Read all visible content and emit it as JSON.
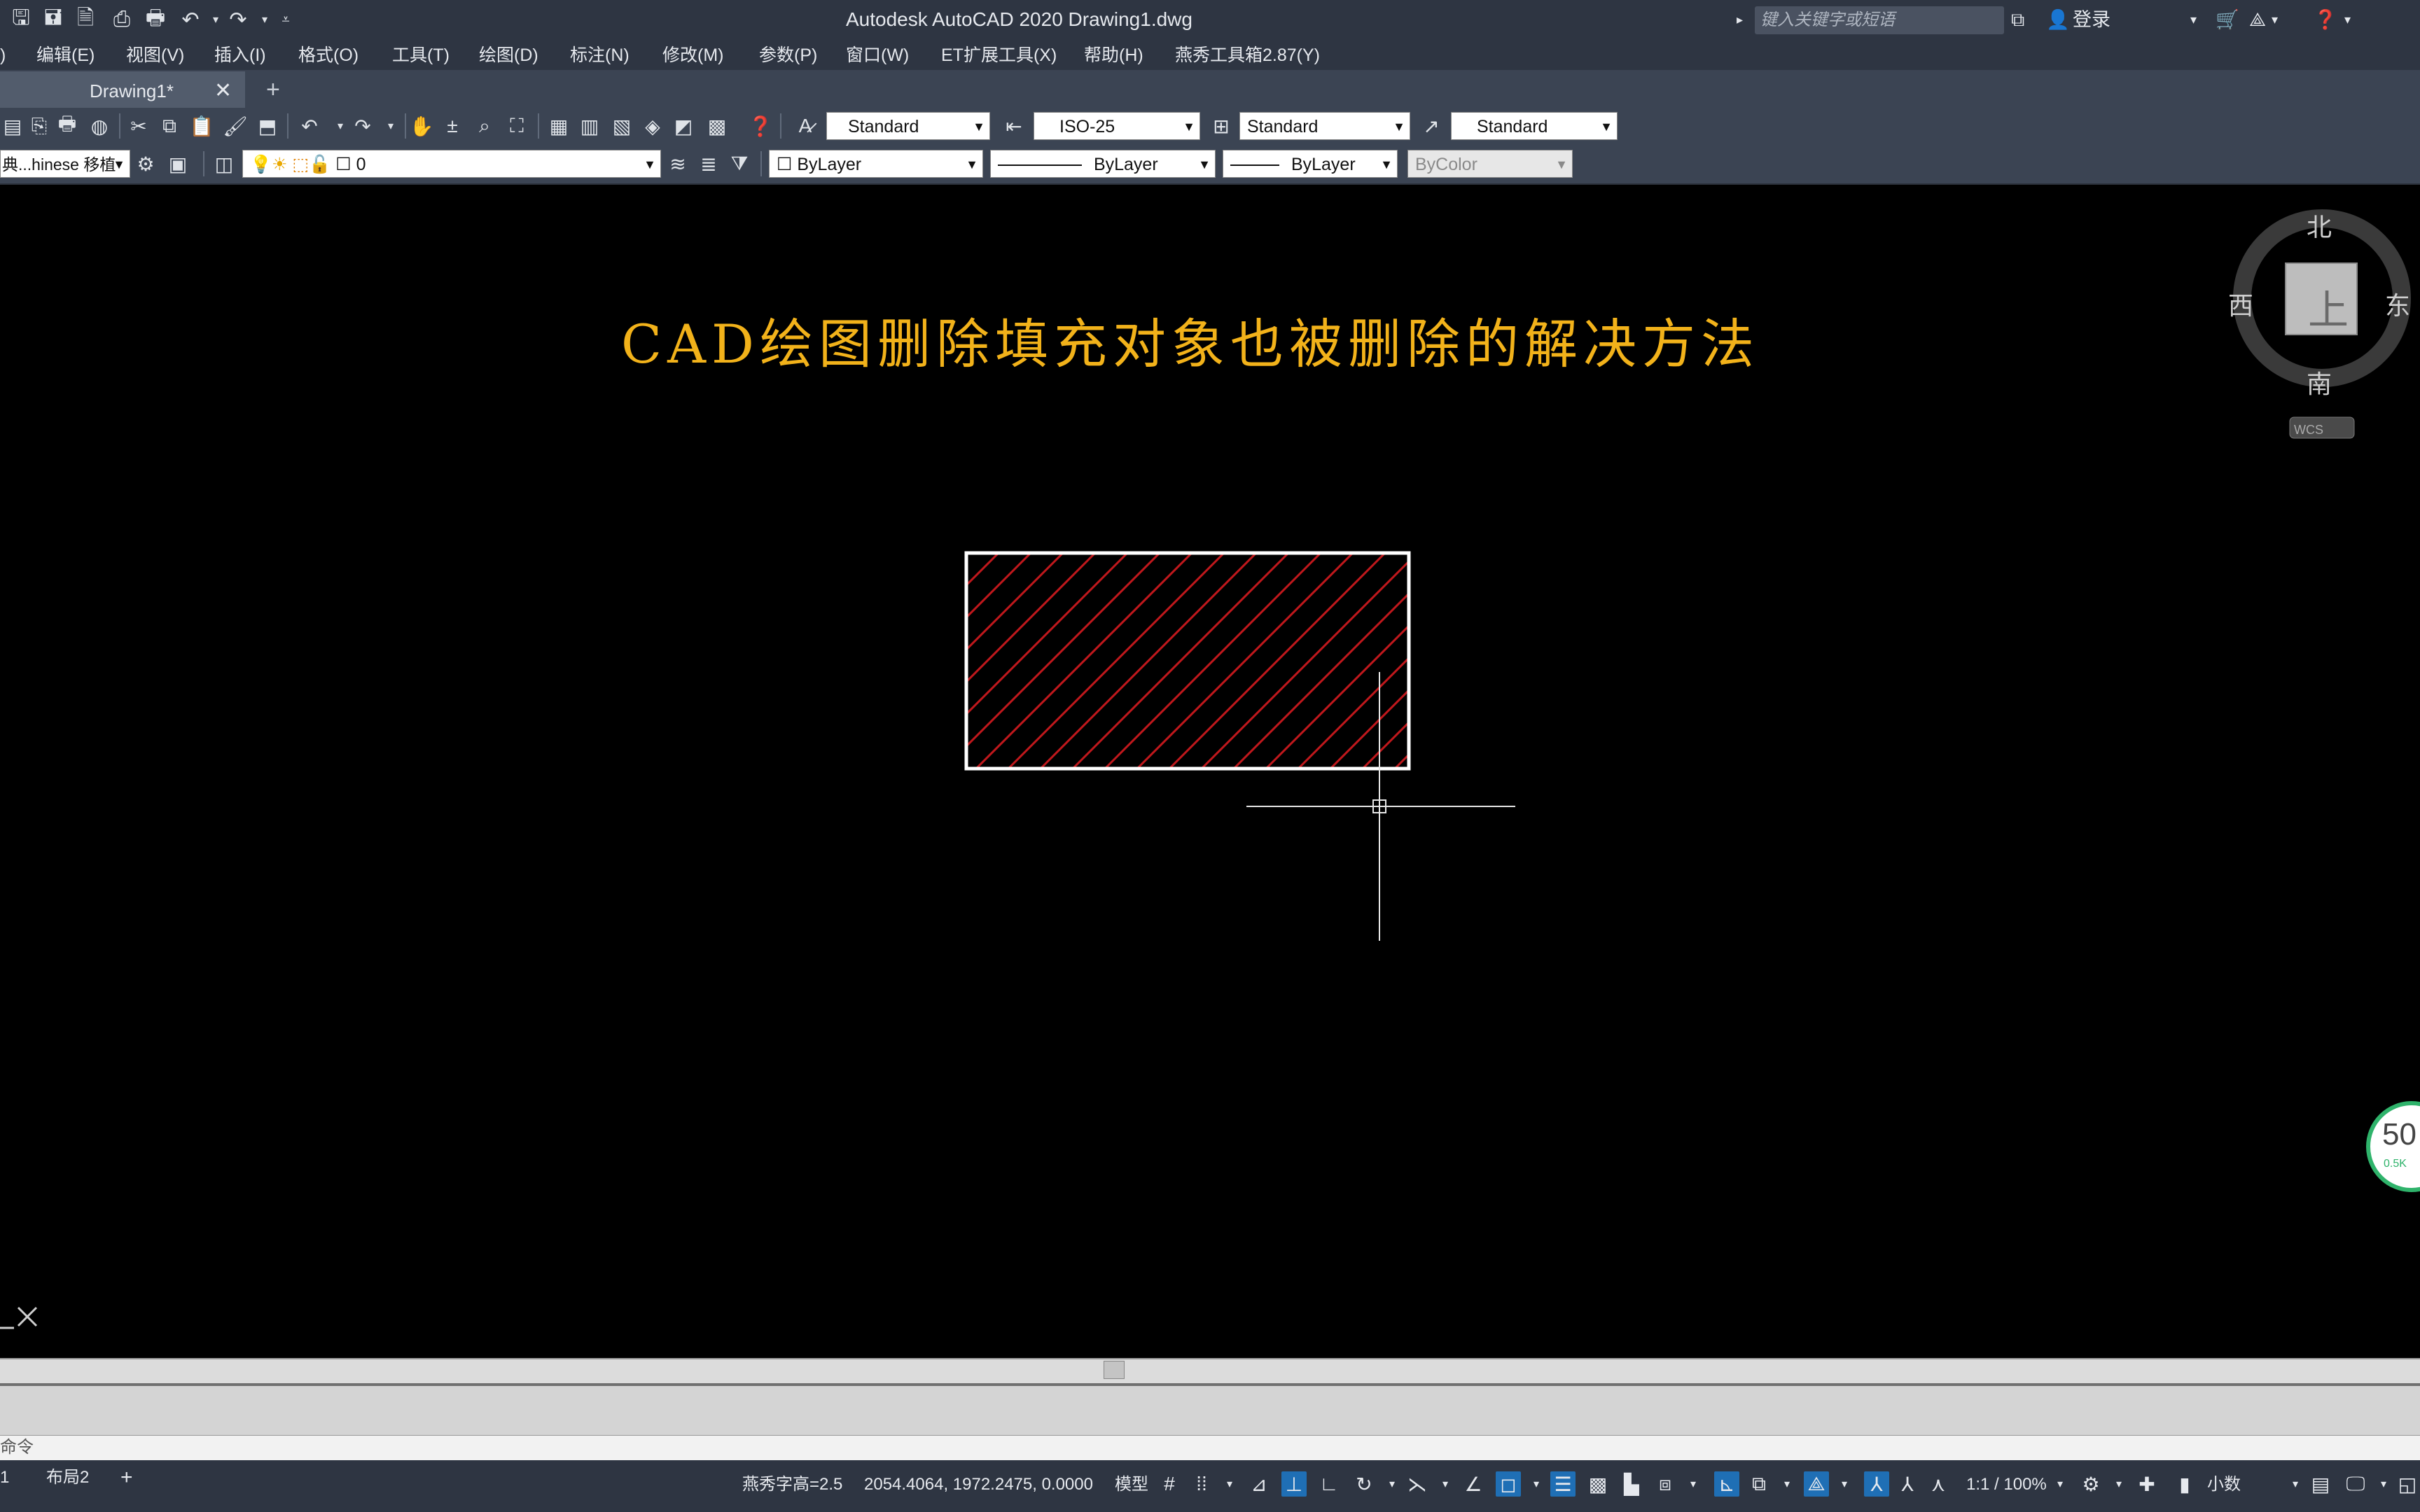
{
  "app": {
    "title": "Autodesk AutoCAD 2020    Drawing1.dwg",
    "search_placeholder": "键入关键字或短语",
    "login": "登录"
  },
  "quick_access": [
    "new-icon",
    "save-icon",
    "saveas-icon",
    "plot-icon",
    "print-icon",
    "undo-icon",
    "redo-icon",
    "customize-icon"
  ],
  "menu": [
    ")",
    "编辑(E)",
    "视图(V)",
    "插入(I)",
    "格式(O)",
    "工具(T)",
    "绘图(D)",
    "标注(N)",
    "修改(M)",
    "参数(P)",
    "窗口(W)",
    "ET扩展工具(X)",
    "帮助(H)",
    "燕秀工具箱2.87(Y)"
  ],
  "tab": {
    "label": "Drawing1*",
    "close": "✕",
    "add": "+"
  },
  "styles": {
    "text_style": "Standard",
    "dim_style": "ISO-25",
    "table_style": "Standard",
    "mleader_style": "Standard"
  },
  "layers": {
    "workspace": "典...hinese 移植",
    "current_layer": "0",
    "color": "ByLayer",
    "linetype": "ByLayer",
    "lineweight": "ByLayer",
    "plotstyle": "ByColor"
  },
  "drawing": {
    "title": "CAD绘图删除填充对象也被删除的解决方法",
    "hatch_color": "#c0181c",
    "boundary_color": "#ffffff",
    "title_color": "#f2b21a"
  },
  "viewcube": {
    "north": "北",
    "south": "南",
    "east": "东",
    "west": "西",
    "face": "上",
    "wcs": "WCS"
  },
  "speed_widget": {
    "value": "50",
    "sub": "0.5K"
  },
  "command": {
    "prompt": "命令"
  },
  "layout_tabs": [
    "1",
    "布局2",
    "+"
  ],
  "status": {
    "yx_text": "燕秀字高=2.5",
    "coords": "2054.4064, 1972.2475, 0.0000",
    "model": "模型",
    "scale": "1:1 / 100%",
    "units": "小数"
  }
}
